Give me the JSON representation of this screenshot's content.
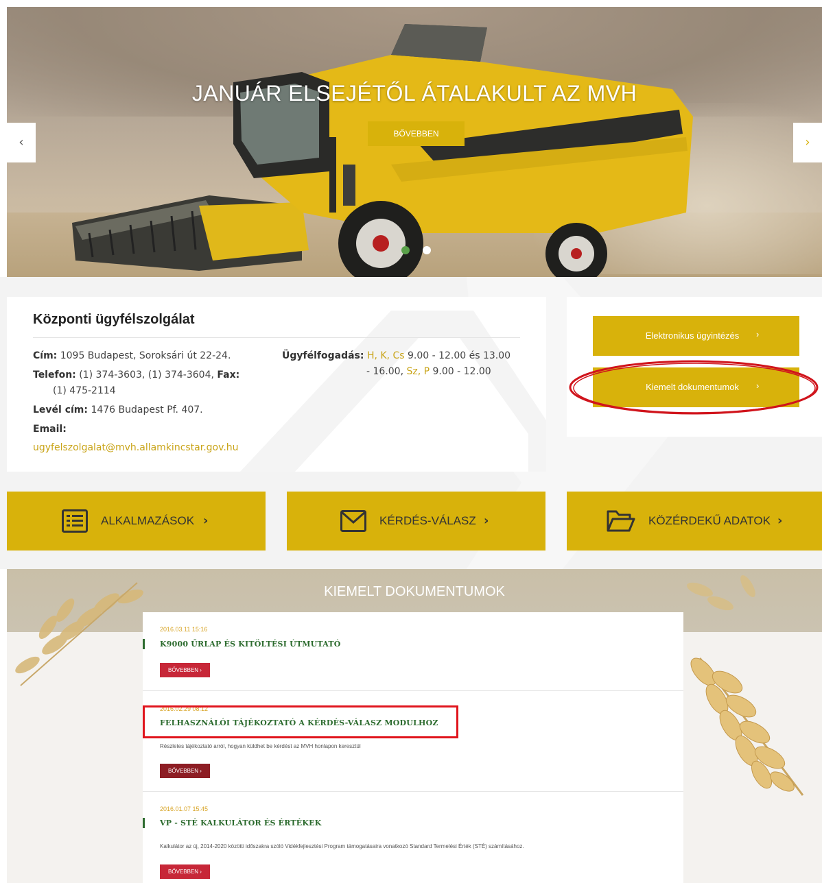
{
  "hero": {
    "title": "JANUÁR ELSEJÉTŐL ÁTALAKULT AZ MVH",
    "more_label": "BŐVEBBEN",
    "prev_label": "‹",
    "next_label": "›",
    "slide_count": 2,
    "active_slide": 1,
    "image": "combine-harvester-photo"
  },
  "contact": {
    "title": "Központi ügyfélszolgálat",
    "address_label": "Cím:",
    "address": "1095 Budapest, Soroksári út 22-24.",
    "phone_label": "Telefon:",
    "phone": "(1) 374-3603, (1) 374-3604,",
    "fax_label": "Fax:",
    "fax": "(1) 475-2114",
    "mail_label": "Levél cím:",
    "mail": "1476 Budapest Pf. 407.",
    "email_label": "Email:",
    "email": "ugyfelszolgalat@mvh.allamkincstar.gov.hu",
    "hours_label": "Ügyfélfogadás:",
    "hours_days1": "H, K, Cs",
    "hours_time1": "9.00 - 12.00 és 13.00",
    "hours_time1b": "- 16.00,",
    "hours_days2": "Sz, P",
    "hours_time2": "9.00 - 12.00"
  },
  "side_buttons": [
    {
      "label": "Elektronikus ügyintézés",
      "chevron": "›"
    },
    {
      "label": "Kiemelt dokumentumok",
      "chevron": "›"
    }
  ],
  "tiles": [
    {
      "label": "ALKALMAZÁSOK",
      "icon": "list-icon",
      "chevron": "›"
    },
    {
      "label": "KÉRDÉS-VÁLASZ",
      "icon": "envelope-icon",
      "chevron": "›"
    },
    {
      "label": "KÖZÉRDEKŰ ADATOK",
      "icon": "folder-icon",
      "chevron": "›"
    }
  ],
  "documents": {
    "heading": "KIEMELT DOKUMENTUMOK",
    "items": [
      {
        "date": "2016.03.11 15:16",
        "title": "K9000 ŰRLAP ÉS KITÖLTÉSI ÚTMUTATÓ",
        "description": "",
        "button": "BŐVEBBEN ›"
      },
      {
        "date": "2016.02.29 08:12",
        "title": "FELHASZNÁLÓI TÁJÉKOZTATÓ A KÉRDÉS-VÁLASZ MODULHOZ",
        "description": "Részletes tájékoztató arról, hogyan küldhet be kérdést az MVH honlapon keresztül",
        "button": "BŐVEBBEN ›"
      },
      {
        "date": "2016.01.07 15:45",
        "title": "VP - STÉ KALKULÁTOR ÉS ÉRTÉKEK",
        "description": "Kalkulátor az új, 2014-2020 közötti időszakra szóló Vidékfejlesztési Program támogatásaira vonatkozó Standard Termelési Érték (STÉ) számításához.",
        "button": "BŐVEBBEN ›"
      }
    ]
  },
  "colors": {
    "accent_gold": "#d8b20b",
    "link_gold": "#c9a418",
    "doc_title_green": "#2c6b2e",
    "doc_button_red": "#c72738",
    "annotation_red": "#e0141c",
    "active_dot_green": "#5aa14a"
  }
}
